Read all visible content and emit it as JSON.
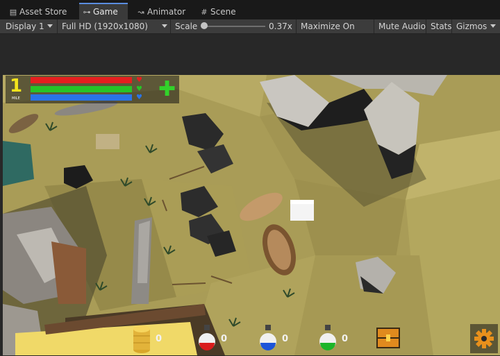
{
  "tabs": [
    {
      "label": "Asset Store",
      "icon": "asset-store-icon"
    },
    {
      "label": "Game",
      "icon": "gamepad-icon"
    },
    {
      "label": "Animator",
      "icon": "animator-icon"
    },
    {
      "label": "Scene",
      "icon": "scene-grid-icon"
    }
  ],
  "toolbar": {
    "display": "Display 1",
    "resolution": "Full HD (1920x1080)",
    "scale_label": "Scale",
    "scale_value": "0.37x",
    "maximize": "Maximize On Play",
    "mute": "Mute Audio",
    "stats": "Stats",
    "gizmos": "Gizmos"
  },
  "hud": {
    "level": "1",
    "level_caption": "MILE",
    "bars": [
      {
        "name": "health",
        "color": "#e51f1f",
        "fill": 1.0
      },
      {
        "name": "stamina",
        "color": "#27c427",
        "fill": 1.0
      },
      {
        "name": "mana",
        "color": "#2a74e6",
        "fill": 1.0
      }
    ]
  },
  "inventory": {
    "coins": "0",
    "red_potion": "0",
    "blue_potion": "0",
    "green_potion": "0"
  },
  "colors": {
    "accent": "#5b8de0",
    "level_yellow": "#f3e31c",
    "plus_green": "#32d22a",
    "chest_orange": "#e08a1e",
    "gear_orange": "#e8901c"
  }
}
